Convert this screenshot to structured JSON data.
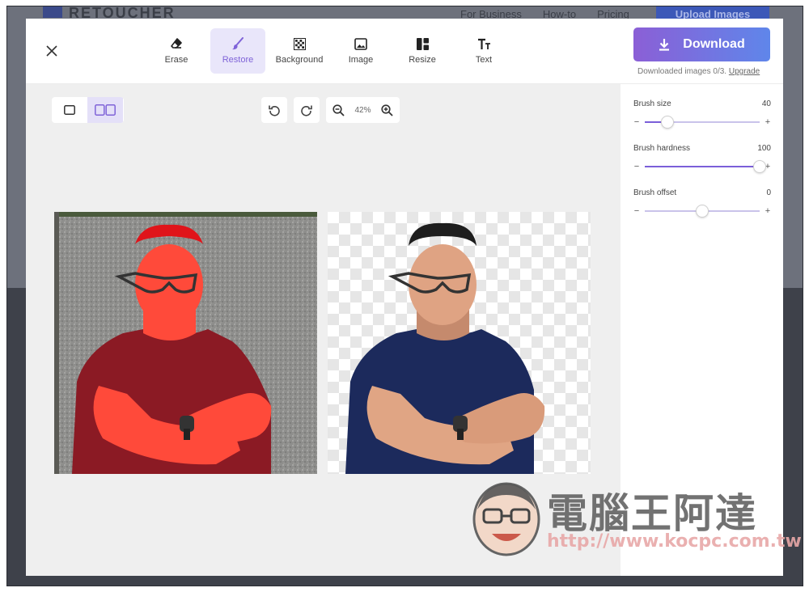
{
  "site": {
    "logo": "RETOUCHER",
    "nav": [
      "For Business",
      "How-to",
      "Pricing"
    ],
    "upload_label": "Upload Images"
  },
  "toolbar": {
    "tools": [
      {
        "label": "Erase",
        "icon": "eraser-icon",
        "active": false
      },
      {
        "label": "Restore",
        "icon": "brush-icon",
        "active": true
      },
      {
        "label": "Background",
        "icon": "checkerboard-icon",
        "active": false
      },
      {
        "label": "Image",
        "icon": "image-icon",
        "active": false
      },
      {
        "label": "Resize",
        "icon": "layout-icon",
        "active": false
      },
      {
        "label": "Text",
        "icon": "text-icon",
        "active": false
      }
    ],
    "download_label": "Download",
    "downloaded_text": "Downloaded images 0/3.",
    "upgrade_label": "Upgrade"
  },
  "canvas": {
    "zoom": "42%",
    "view_mode": "split"
  },
  "brush": {
    "size": {
      "label": "Brush size",
      "value": "40",
      "fraction": 0.2
    },
    "hardness": {
      "label": "Brush hardness",
      "value": "100",
      "fraction": 1.0
    },
    "offset": {
      "label": "Brush offset",
      "value": "0",
      "fraction": 0.5
    }
  },
  "watermark": {
    "title": "電腦王阿達",
    "url": "http://www.kocpc.com.tw"
  },
  "colors": {
    "accent": "#7f63d8",
    "highlight_overlay": "#ff4a3a"
  }
}
